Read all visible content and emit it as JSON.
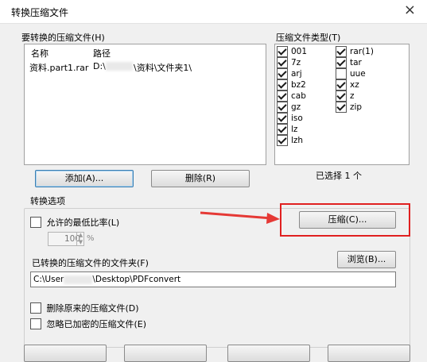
{
  "window": {
    "title": "转换压缩文件",
    "close_glyph": "×"
  },
  "files_group": {
    "label": "要转换的压缩文件(H)",
    "columns": [
      "名称",
      "路径"
    ],
    "rows": [
      {
        "name": "资料.part1.rar",
        "path_prefix": "D:\\",
        "path_suffix": "\\资料\\文件夹1\\"
      }
    ],
    "add_button": "添加(A)...",
    "delete_button": "删除(R)"
  },
  "types_group": {
    "label": "压缩文件类型(T)",
    "col1": [
      {
        "label": "001",
        "checked": true
      },
      {
        "label": "7z",
        "checked": true
      },
      {
        "label": "arj",
        "checked": true
      },
      {
        "label": "bz2",
        "checked": true
      },
      {
        "label": "cab",
        "checked": true
      },
      {
        "label": "gz",
        "checked": true
      },
      {
        "label": "iso",
        "checked": true
      },
      {
        "label": "lz",
        "checked": true
      },
      {
        "label": "lzh",
        "checked": true
      }
    ],
    "col2": [
      {
        "label": "rar(1)",
        "checked": true
      },
      {
        "label": "tar",
        "checked": true
      },
      {
        "label": "uue",
        "checked": false
      },
      {
        "label": "xz",
        "checked": true
      },
      {
        "label": "z",
        "checked": true
      },
      {
        "label": "zip",
        "checked": true
      }
    ],
    "selected_count": "已选择 1 个"
  },
  "options_group": {
    "label": "转换选项",
    "min_ratio_label": "允许的最低比率(L)",
    "min_ratio_value": "100",
    "min_ratio_unit": "%",
    "compress_button": "压缩(C)...",
    "folder_label": "已转换的压缩文件的文件夹(F)",
    "browse_button": "浏览(B)...",
    "folder_path_prefix": "C:\\User",
    "folder_path_suffix": "\\Desktop\\PDFconvert",
    "delete_original_label": "删除原来的压缩文件(D)",
    "ignore_encrypted_label": "忽略已加密的压缩文件(E)"
  },
  "colors": {
    "highlight_box": "#e02020",
    "arrow": "#e53935",
    "dialog_bg": "#f0f0f0"
  }
}
